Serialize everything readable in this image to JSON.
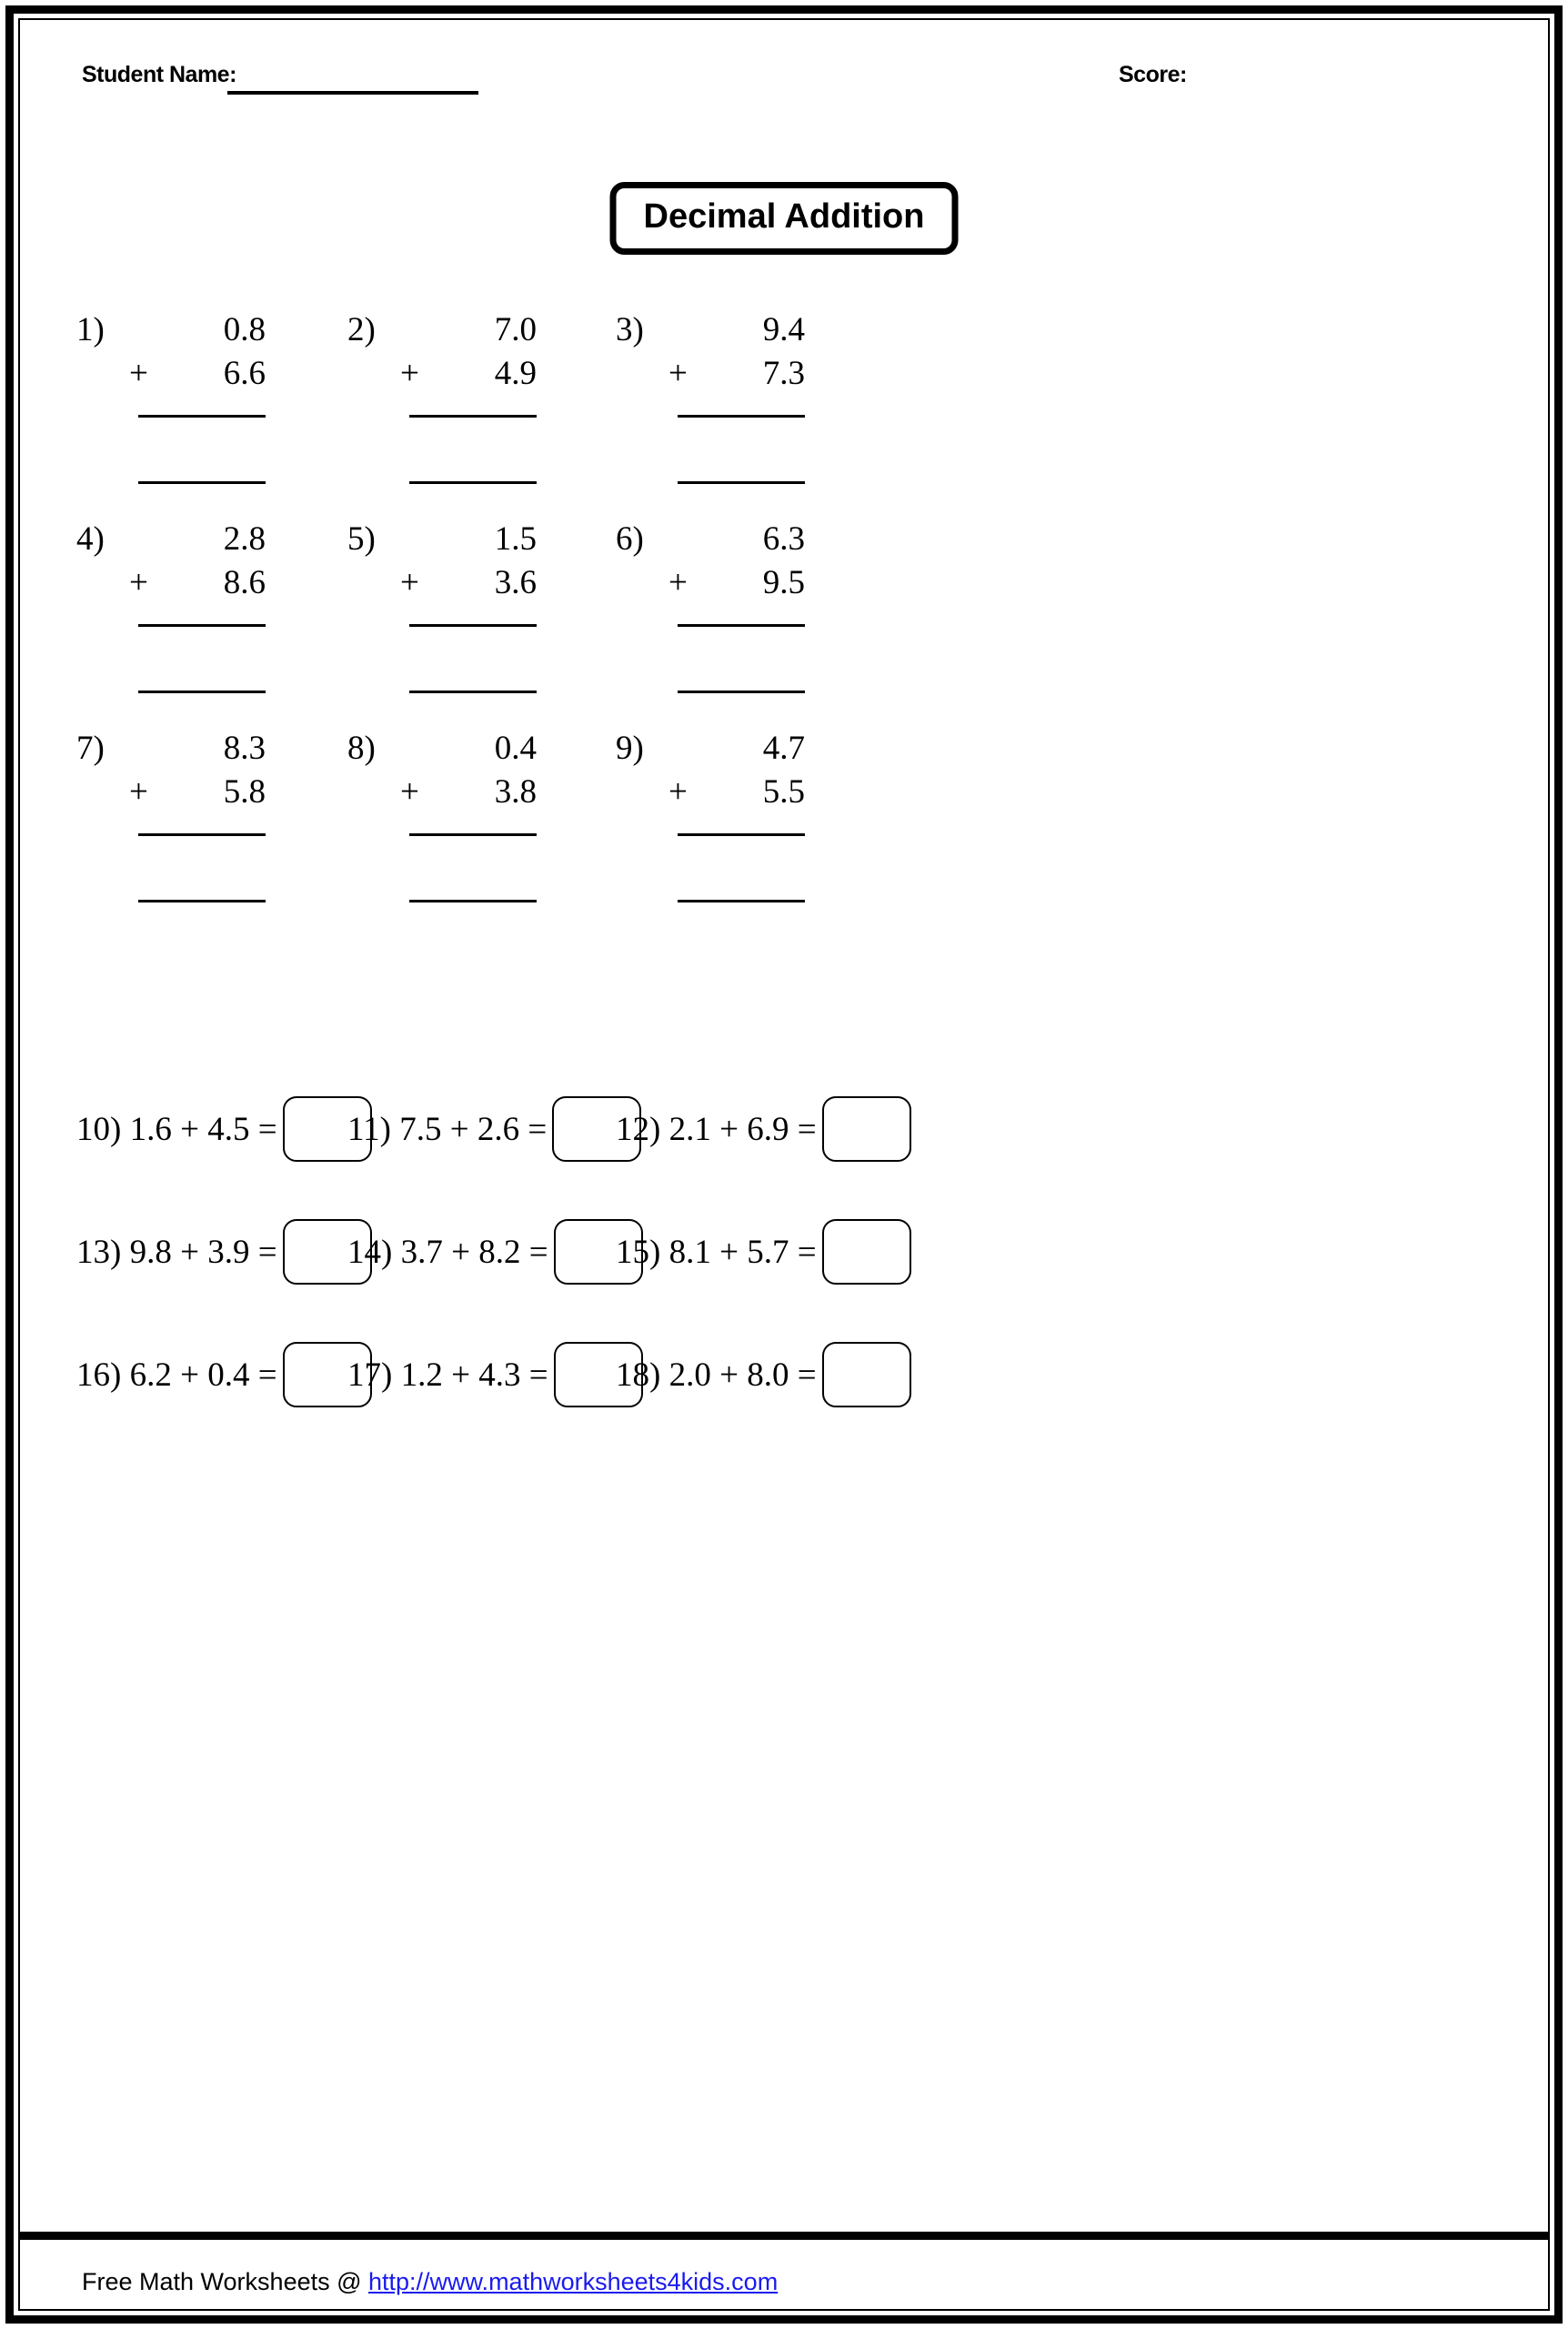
{
  "header": {
    "student_name_label": "Student Name:",
    "score_label": "Score:"
  },
  "title": "Decimal Addition",
  "vertical_problems": [
    {
      "index": "1)",
      "addend1": "0.8",
      "operator": "+",
      "addend2": "6.6"
    },
    {
      "index": "2)",
      "addend1": "7.0",
      "operator": "+",
      "addend2": "4.9"
    },
    {
      "index": "3)",
      "addend1": "9.4",
      "operator": "+",
      "addend2": "7.3"
    },
    {
      "index": "4)",
      "addend1": "2.8",
      "operator": "+",
      "addend2": "8.6"
    },
    {
      "index": "5)",
      "addend1": "1.5",
      "operator": "+",
      "addend2": "3.6"
    },
    {
      "index": "6)",
      "addend1": "6.3",
      "operator": "+",
      "addend2": "9.5"
    },
    {
      "index": "7)",
      "addend1": "8.3",
      "operator": "+",
      "addend2": "5.8"
    },
    {
      "index": "8)",
      "addend1": "0.4",
      "operator": "+",
      "addend2": "3.8"
    },
    {
      "index": "9)",
      "addend1": "4.7",
      "operator": "+",
      "addend2": "5.5"
    }
  ],
  "horizontal_problems": [
    {
      "index": "10)",
      "expression": "10) 1.6 + 4.5 =",
      "addend1": "1.6",
      "addend2": "4.5",
      "answer": ""
    },
    {
      "index": "11)",
      "expression": "11) 7.5 + 2.6 =",
      "addend1": "7.5",
      "addend2": "2.6",
      "answer": ""
    },
    {
      "index": "12)",
      "expression": "12) 2.1 + 6.9 =",
      "addend1": "2.1",
      "addend2": "6.9",
      "answer": ""
    },
    {
      "index": "13)",
      "expression": "13) 9.8 + 3.9 =",
      "addend1": "9.8",
      "addend2": "3.9",
      "answer": ""
    },
    {
      "index": "14)",
      "expression": "14) 3.7 + 8.2 =",
      "addend1": "3.7",
      "addend2": "8.2",
      "answer": ""
    },
    {
      "index": "15)",
      "expression": "15) 8.1 + 5.7 =",
      "addend1": "8.1",
      "addend2": "5.7",
      "answer": ""
    },
    {
      "index": "16)",
      "expression": "16) 6.2 + 0.4 =",
      "addend1": "6.2",
      "addend2": "0.4",
      "answer": ""
    },
    {
      "index": "17)",
      "expression": "17) 1.2 + 4.3 =",
      "addend1": "1.2",
      "addend2": "4.3",
      "answer": ""
    },
    {
      "index": "18)",
      "expression": "18) 2.0 + 8.0 =",
      "addend1": "2.0",
      "addend2": "8.0",
      "answer": ""
    }
  ],
  "footer": {
    "text": "Free Math Worksheets @ ",
    "link": "http://www.mathworksheets4kids.com",
    "link_color": "#1a1aee"
  }
}
